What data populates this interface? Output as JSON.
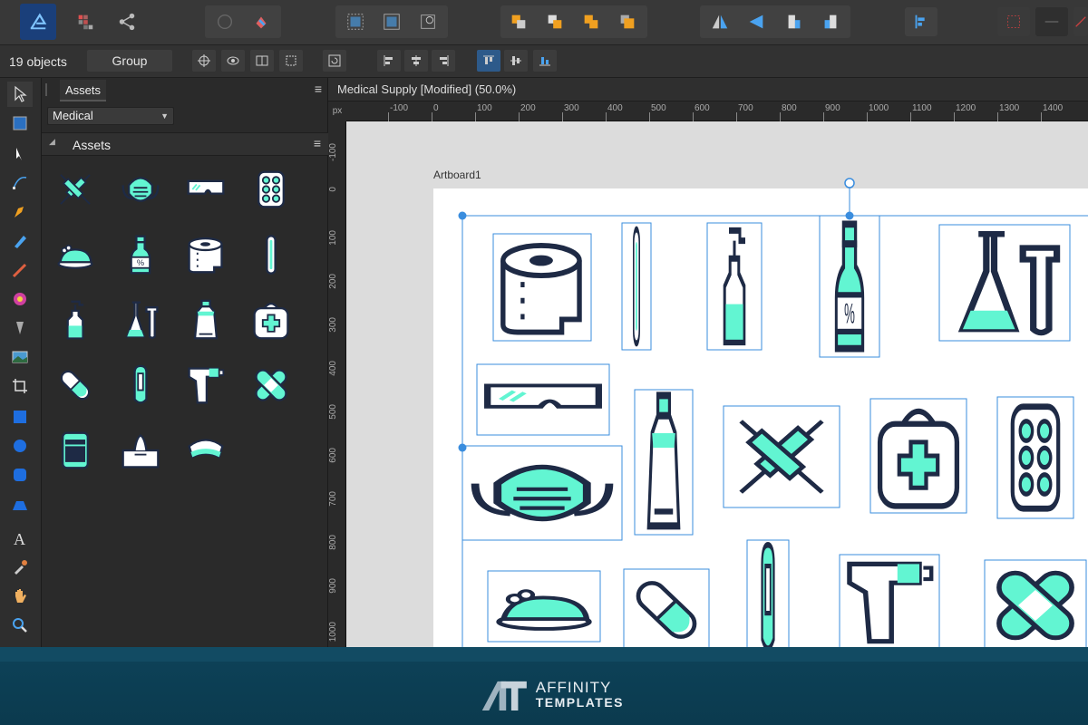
{
  "app": {
    "document_title": "Medical Supply [Modified] (50.0%)",
    "accent_color": "#3a8dde",
    "icon_fill_color": "#62f5d2",
    "icon_stroke_color": "#1e2a45"
  },
  "context_toolbar": {
    "selection_count": "19 objects",
    "group_label": "Group"
  },
  "assets_panel": {
    "tab_label": "Assets",
    "category_selected": "Medical",
    "section_label": "Assets",
    "menu_glyph": "≡",
    "items": [
      "syringes-icon",
      "mask-icon",
      "goggles-icon",
      "pill-blister-icon",
      "mouse-icon",
      "percent-bottle-icon",
      "toilet-paper-icon",
      "thermometer-icon",
      "dropper-bottle-icon",
      "flask-icon",
      "tube-icon",
      "first-aid-kit-icon",
      "capsule-icon",
      "digital-thermometer-icon",
      "thermometer-gun-icon",
      "bandage-icon",
      "jar-icon",
      "tissue-box-icon",
      "cap-icon"
    ]
  },
  "canvas": {
    "ruler_unit": "px",
    "h_ticks": [
      "-100",
      "0",
      "100",
      "200",
      "300",
      "400",
      "500",
      "600",
      "700",
      "800",
      "900",
      "1000",
      "1100",
      "1200",
      "1300",
      "1400"
    ],
    "v_ticks": [
      "-100",
      "0",
      "100",
      "200",
      "300",
      "400",
      "500",
      "600",
      "700",
      "800",
      "900",
      "1000"
    ],
    "artboard_label": "Artboard1",
    "percent_label": "%"
  },
  "footer": {
    "brand_line1": "AFFINITY",
    "brand_line2": "TEMPLATES"
  }
}
